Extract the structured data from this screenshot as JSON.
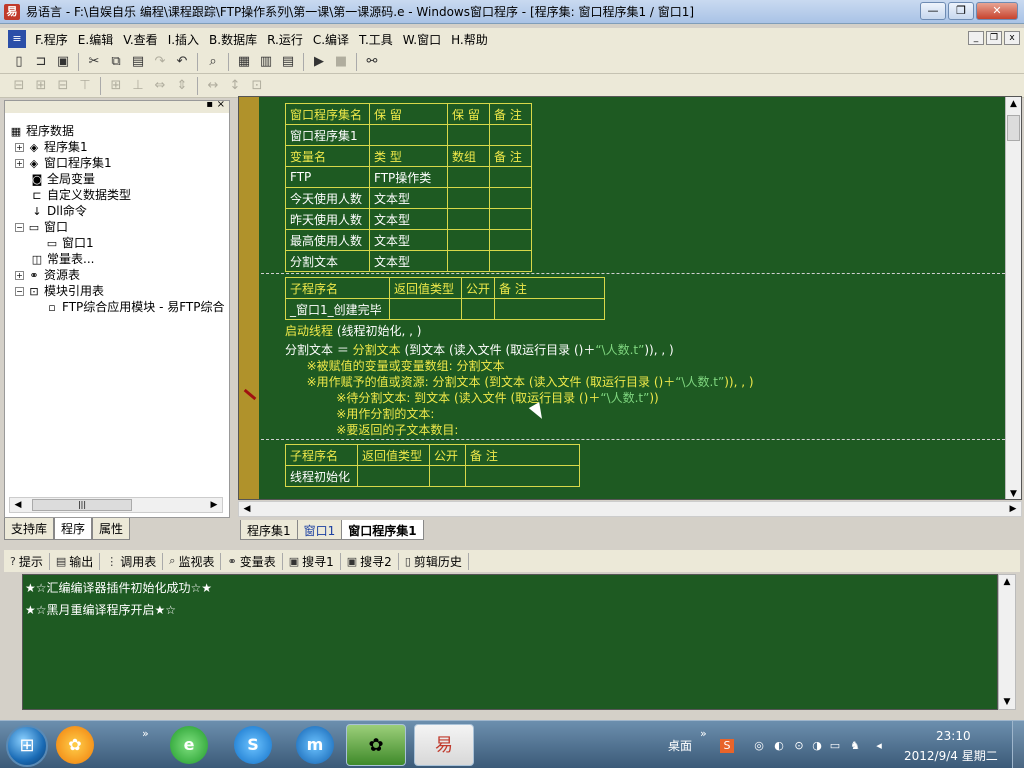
{
  "window": {
    "title": "易语言 - F:\\自娱自乐 编程\\课程跟踪\\FTP操作系列\\第一课\\第一课源码.e - Windows窗口程序 - [程序集: 窗口程序集1 / 窗口1]",
    "minimize": "—",
    "maximize": "❐",
    "close": "✕"
  },
  "menu": {
    "items": [
      "F.程序",
      "E.编辑",
      "V.查看",
      "I.插入",
      "B.数据库",
      "R.运行",
      "C.编译",
      "T.工具",
      "W.窗口",
      "H.帮助"
    ],
    "mdi": [
      "_",
      "❐",
      "x"
    ]
  },
  "left_panel": {
    "header_buttons": [
      "▪",
      "×"
    ],
    "tree": [
      {
        "label": "程序数据",
        "depth": 0,
        "expander": "",
        "icon": "database-icon"
      },
      {
        "label": "程序集1",
        "depth": 1,
        "expander": "+",
        "icon": "stack-icon"
      },
      {
        "label": "窗口程序集1",
        "depth": 1,
        "expander": "+",
        "icon": "stack-icon"
      },
      {
        "label": "全局变量",
        "depth": 1,
        "expander": "",
        "icon": "jar-icon"
      },
      {
        "label": "自定义数据类型",
        "depth": 1,
        "expander": "",
        "icon": "datatype-icon"
      },
      {
        "label": "Dll命令",
        "depth": 1,
        "expander": "",
        "icon": "dll-icon"
      },
      {
        "label": "窗口",
        "depth": 1,
        "expander": "−",
        "icon": "window-icon"
      },
      {
        "label": "窗口1",
        "depth": 2,
        "expander": "",
        "icon": "window-icon"
      },
      {
        "label": "常量表...",
        "depth": 1,
        "expander": "",
        "icon": "constants-icon"
      },
      {
        "label": "资源表",
        "depth": 1,
        "expander": "+",
        "icon": "resource-icon"
      },
      {
        "label": "模块引用表",
        "depth": 1,
        "expander": "−",
        "icon": "module-icon"
      },
      {
        "label": "FTP综合应用模块 - 易FTP综合",
        "depth": 2,
        "expander": "",
        "icon": "module-file-icon"
      }
    ],
    "tabs": [
      "支持库",
      "程序",
      "属性"
    ]
  },
  "editor": {
    "assembly_table": {
      "header": [
        "窗口程序集名",
        "保 留",
        "保 留",
        "备 注"
      ],
      "name_row": [
        "窗口程序集1",
        "",
        "",
        ""
      ],
      "var_header": [
        "变量名",
        "类 型",
        "数组",
        "备 注"
      ],
      "vars": [
        [
          "FTP",
          "FTP操作类",
          "",
          ""
        ],
        [
          "今天使用人数",
          "文本型",
          "",
          ""
        ],
        [
          "昨天使用人数",
          "文本型",
          "",
          ""
        ],
        [
          "最高使用人数",
          "文本型",
          "",
          ""
        ],
        [
          "分割文本",
          "文本型",
          "",
          ""
        ]
      ]
    },
    "sub1_table": {
      "header": [
        "子程序名",
        "返回值类型",
        "公开",
        "备 注"
      ],
      "row": [
        "_窗口1_创建完毕",
        "",
        "",
        ""
      ]
    },
    "code_lines": {
      "l1a": "启动线程",
      "l1b": " (线程初始化, , )",
      "l2a": "分割文本 ＝ ",
      "l2b": "分割文本",
      "l2c": " (到文本 (读入文件 (取运行目录 ()＋",
      "l2d": "“\\人数.t”",
      "l2e": ")), , )",
      "l3": "  ※被赋值的变量或变量数组: 分割文本",
      "l4a": "  ※用作赋予的值或资源: 分割文本 (到文本 (读入文件 (取运行目录 ()＋",
      "l4b": "“\\人数.t”",
      "l4c": ")), , )",
      "l5a": "    ※待分割文本: 到文本 (读入文件 (取运行目录 ()＋",
      "l5b": "“\\人数.t”",
      "l5c": "))",
      "l6": "    ※用作分割的文本:",
      "l7": "    ※要返回的子文本数目:"
    },
    "sub2_table": {
      "header": [
        "子程序名",
        "返回值类型",
        "公开",
        "备 注"
      ],
      "row": [
        "线程初始化",
        "",
        "",
        ""
      ]
    },
    "tabs": [
      "程序集1",
      "窗口1",
      "窗口程序集1"
    ]
  },
  "output": {
    "tabs": [
      "提示",
      "输出",
      "调用表",
      "监视表",
      "变量表",
      "搜寻1",
      "搜寻2",
      "剪辑历史"
    ],
    "lines": [
      "★☆汇编编译器插件初始化成功☆★",
      "★☆黑月重编译程序开启★☆"
    ]
  },
  "taskbar": {
    "desktop_label": "桌面",
    "time": "23:10",
    "date": "2012/9/4 星期二"
  },
  "colors": {
    "editor_bg": "#1e5a22",
    "table_border": "#d8d84a",
    "keyword": "#f0e94a",
    "string": "#7fd67f",
    "gutter": "#b0922b"
  }
}
